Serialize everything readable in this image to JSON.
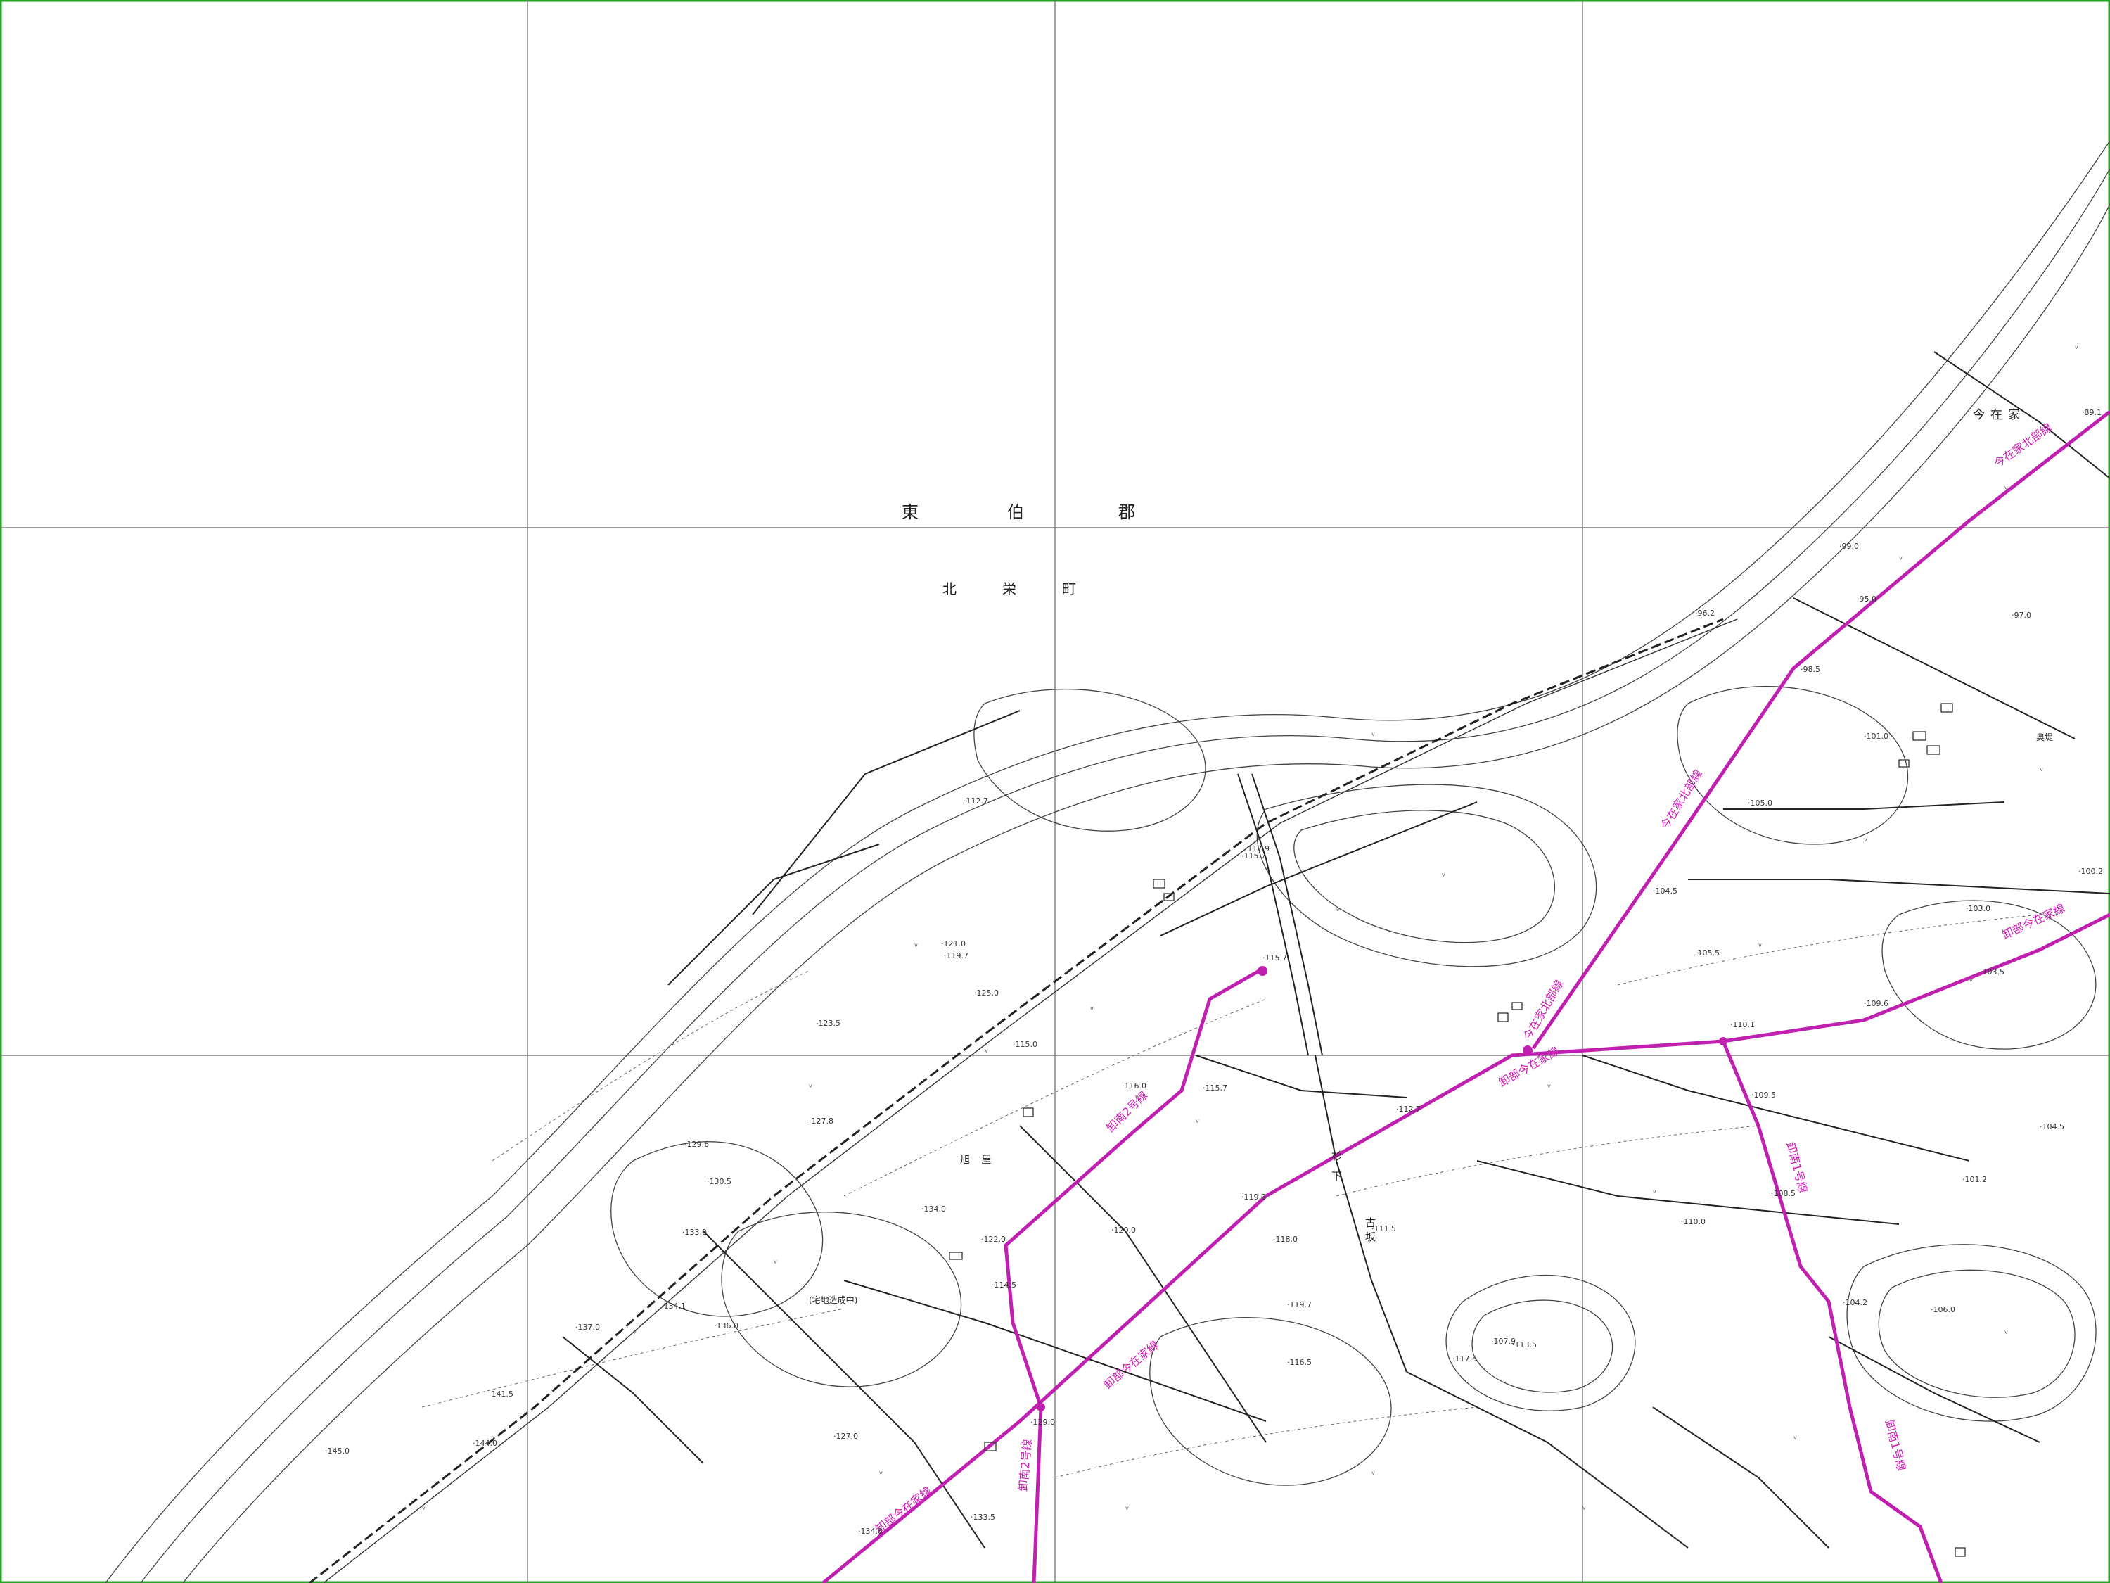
{
  "map": {
    "district": [
      "東",
      "伯",
      "郡"
    ],
    "town": [
      "北",
      "栄",
      "町"
    ],
    "places": {
      "imazaike": "今在家",
      "asahi": "旭 屋",
      "sugishita": "杉下",
      "yoshi": "古 坂",
      "ibaragi": "奥堤",
      "construction": "(宅地造成中)"
    },
    "route_labels": {
      "kawabe_imazaike": "卸部今在家線",
      "kawabe_imazaike_2": "卸部今在家線",
      "kawabe_imazaike_3": "卸部今在家線",
      "kawabe_imazaike_4": "卸部今在家線",
      "imazaike_north": "今在家北部線",
      "imazaike_north_2": "今在家北部線",
      "imazaike_north_3": "今在家北部線",
      "south2_a": "卸南2号線",
      "south2_b": "卸南2号線",
      "south1_a": "卸南1号線",
      "south1_b": "卸南1号線"
    },
    "spot_heights": [
      {
        "id": "h1",
        "v": "112.7"
      },
      {
        "id": "h2",
        "v": "119.7"
      },
      {
        "id": "h3",
        "v": "121.0"
      },
      {
        "id": "h4",
        "v": "123.5"
      },
      {
        "id": "h5",
        "v": "125.0"
      },
      {
        "id": "h6",
        "v": "127.8"
      },
      {
        "id": "h7",
        "v": "129.6"
      },
      {
        "id": "h8",
        "v": "130.5"
      },
      {
        "id": "h9",
        "v": "133.0"
      },
      {
        "id": "h10",
        "v": "134.0"
      },
      {
        "id": "h11",
        "v": "134.1"
      },
      {
        "id": "h12",
        "v": "136.0"
      },
      {
        "id": "h13",
        "v": "137.0"
      },
      {
        "id": "h14",
        "v": "141.5"
      },
      {
        "id": "h15",
        "v": "144.0"
      },
      {
        "id": "h16",
        "v": "145.0"
      },
      {
        "id": "h17",
        "v": "134.8"
      },
      {
        "id": "h18",
        "v": "133.5"
      },
      {
        "id": "h19",
        "v": "129.0"
      },
      {
        "id": "h20",
        "v": "127.0"
      },
      {
        "id": "h21",
        "v": "122.0"
      },
      {
        "id": "h22",
        "v": "114.5"
      },
      {
        "id": "h23",
        "v": "120.0"
      },
      {
        "id": "h24",
        "v": "116.0"
      },
      {
        "id": "h25",
        "v": "115.0"
      },
      {
        "id": "h26",
        "v": "119.0"
      },
      {
        "id": "h27",
        "v": "118.0"
      },
      {
        "id": "h28",
        "v": "119.7"
      },
      {
        "id": "h29",
        "v": "116.5"
      },
      {
        "id": "h30",
        "v": "115.7"
      },
      {
        "id": "h31",
        "v": "112.7"
      },
      {
        "id": "h32",
        "v": "111.5"
      },
      {
        "id": "h33",
        "v": "113.5"
      },
      {
        "id": "h34",
        "v": "117.5"
      },
      {
        "id": "h35",
        "v": "110.0"
      },
      {
        "id": "h36",
        "v": "107.9"
      },
      {
        "id": "h37",
        "v": "110.1"
      },
      {
        "id": "h38",
        "v": "109.5"
      },
      {
        "id": "h39",
        "v": "108.5"
      },
      {
        "id": "h40",
        "v": "105.0"
      },
      {
        "id": "h41",
        "v": "104.5"
      },
      {
        "id": "h42",
        "v": "101.0"
      },
      {
        "id": "h43",
        "v": "100.2"
      },
      {
        "id": "h44",
        "v": "103.0"
      },
      {
        "id": "h45",
        "v": "103.5"
      },
      {
        "id": "h46",
        "v": "104.5"
      },
      {
        "id": "h47",
        "v": "101.2"
      },
      {
        "id": "h48",
        "v": "106.0"
      },
      {
        "id": "h49",
        "v": "104.2"
      },
      {
        "id": "h50",
        "v": "98.5"
      },
      {
        "id": "h51",
        "v": "96.2"
      },
      {
        "id": "h52",
        "v": "97.0"
      },
      {
        "id": "h53",
        "v": "95.0"
      },
      {
        "id": "h54",
        "v": "99.0"
      },
      {
        "id": "h55",
        "v": "89.1"
      },
      {
        "id": "h56",
        "v": "105.5"
      },
      {
        "id": "h57",
        "v": "109.6"
      },
      {
        "id": "h58",
        "v": "115.7"
      },
      {
        "id": "h59",
        "v": "117.9"
      },
      {
        "id": "h60",
        "v": "115.7"
      }
    ]
  }
}
